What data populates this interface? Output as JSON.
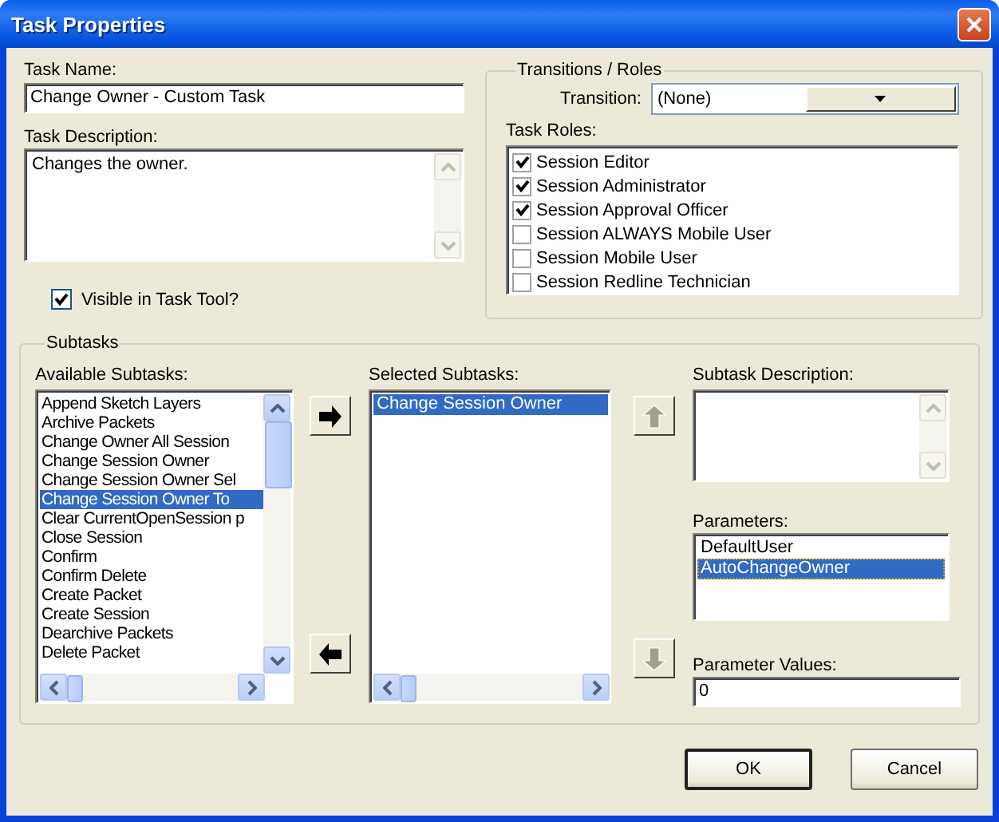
{
  "window": {
    "title": "Task Properties"
  },
  "task_name": {
    "label": "Task Name:",
    "value": "Change Owner - Custom Task"
  },
  "task_description": {
    "label": "Task Description:",
    "value": "Changes the owner."
  },
  "visible_in_task_tool": {
    "label": "Visible in Task Tool?",
    "checked": true
  },
  "transitions_roles": {
    "title": "Transitions / Roles",
    "transition": {
      "label": "Transition:",
      "value": "(None)"
    },
    "task_roles": {
      "label": "Task Roles:",
      "items": [
        {
          "label": "Session Editor",
          "checked": true
        },
        {
          "label": "Session Administrator",
          "checked": true
        },
        {
          "label": "Session Approval Officer",
          "checked": true
        },
        {
          "label": "Session ALWAYS Mobile User",
          "checked": false
        },
        {
          "label": "Session Mobile User",
          "checked": false
        },
        {
          "label": "Session Redline Technician",
          "checked": false
        }
      ]
    }
  },
  "subtasks": {
    "title": "Subtasks",
    "available": {
      "label": "Available Subtasks:",
      "items": [
        {
          "label": "Append Sketch Layers",
          "selected": false
        },
        {
          "label": "Archive Packets",
          "selected": false
        },
        {
          "label": "Change Owner All Session",
          "selected": false
        },
        {
          "label": "Change Session Owner",
          "selected": false
        },
        {
          "label": "Change Session Owner Sel",
          "selected": false
        },
        {
          "label": "Change Session Owner To",
          "selected": true
        },
        {
          "label": "Clear CurrentOpenSession p",
          "selected": false
        },
        {
          "label": "Close Session",
          "selected": false
        },
        {
          "label": "Confirm",
          "selected": false
        },
        {
          "label": "Confirm Delete",
          "selected": false
        },
        {
          "label": "Create Packet",
          "selected": false
        },
        {
          "label": "Create Session",
          "selected": false
        },
        {
          "label": "Dearchive Packets",
          "selected": false
        },
        {
          "label": "Delete Packet",
          "selected": false
        }
      ]
    },
    "move_buttons": [
      {
        "kind": "right",
        "disabled": false
      },
      {
        "kind": "left",
        "disabled": false
      },
      {
        "kind": "up",
        "disabled": true
      },
      {
        "kind": "down",
        "disabled": true
      }
    ],
    "selected": {
      "label": "Selected Subtasks:",
      "items": [
        {
          "label": "Change Session Owner",
          "selected": true
        }
      ]
    },
    "subtask_description": {
      "label": "Subtask Description:"
    },
    "parameters": {
      "label": "Parameters:",
      "items": [
        {
          "label": "DefaultUser",
          "selected": false
        },
        {
          "label": "AutoChangeOwner",
          "selected": true
        }
      ]
    },
    "parameter_values": {
      "label": "Parameter Values:",
      "value": "0"
    }
  },
  "buttons": [
    {
      "label": "OK",
      "default": true
    },
    {
      "label": "Cancel",
      "default": false
    }
  ]
}
